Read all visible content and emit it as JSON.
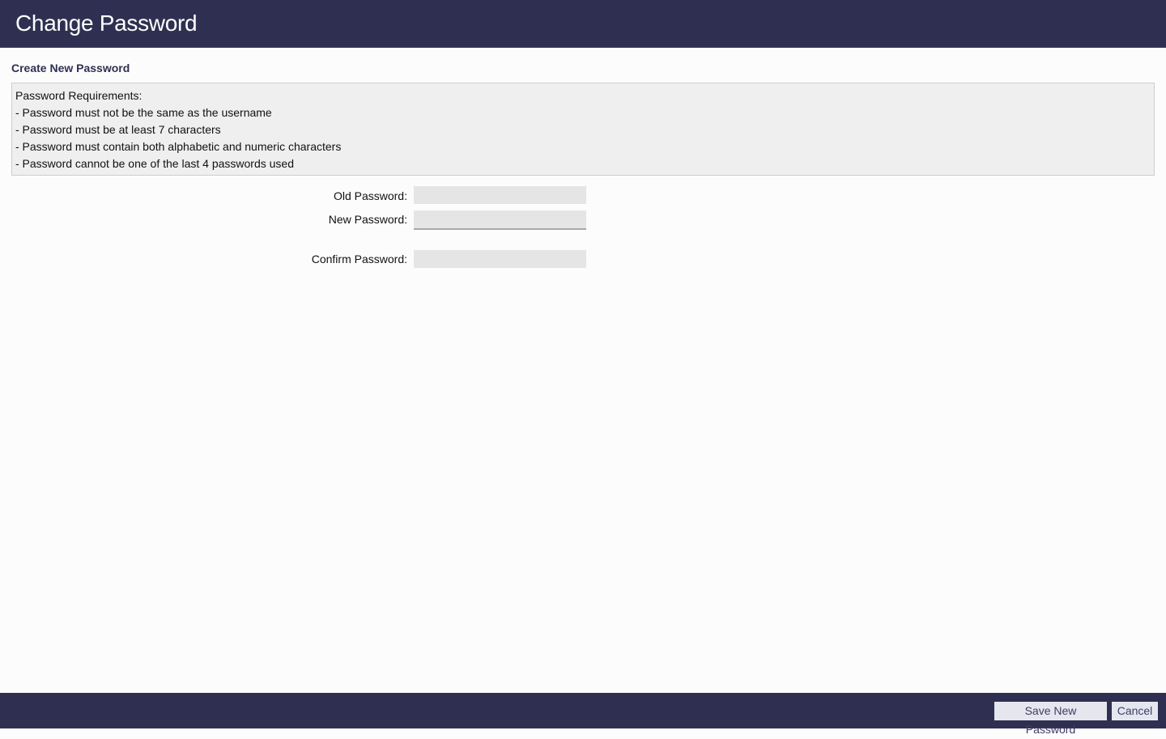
{
  "header": {
    "title": "Change Password"
  },
  "section": {
    "title": "Create New Password"
  },
  "requirements": {
    "heading": "Password Requirements:",
    "items": [
      "- Password must not be the same as the username",
      "- Password must be at least 7 characters",
      "- Password must contain both alphabetic and numeric characters",
      "- Password cannot be one of the last 4 passwords used"
    ]
  },
  "form": {
    "old_password_label": "Old Password:",
    "old_password_value": "",
    "new_password_label": "New Password:",
    "new_password_value": "",
    "confirm_password_label": "Confirm Password:",
    "confirm_password_value": ""
  },
  "footer": {
    "save_label": "Save New Password",
    "cancel_label": "Cancel"
  },
  "colors": {
    "header_bg": "#2f3051",
    "accent_text": "#2f3051",
    "panel_bg": "#efefef",
    "input_bg": "#e5e5e5",
    "button_bg": "#e6e6ee"
  }
}
